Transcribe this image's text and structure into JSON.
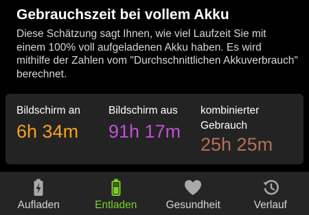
{
  "section": {
    "title": "Gebrauchszeit bei vollem Akku",
    "description": "Diese Schätzung sagt Ihnen, wie viel Laufzeit Sie mit einem 100% voll aufgeladenen Akku haben. Es wird mithilfe der Zahlen vom \"Durchschnittlichen Akkuverbrauch\" berechnet."
  },
  "stats": [
    {
      "label": "Bildschirm an",
      "value": "6h 34m",
      "color": "#f5a21b"
    },
    {
      "label": "Bildschirm aus",
      "value": "91h 17m",
      "color": "#c150d8"
    },
    {
      "label": "kombinierter Gebrauch",
      "value": "25h 25m",
      "color": "#b5705a"
    }
  ],
  "tabs": [
    {
      "label": "Aufladen",
      "icon": "battery-charging-icon",
      "active": false
    },
    {
      "label": "Entladen",
      "icon": "battery-discharging-icon",
      "active": true
    },
    {
      "label": "Gesundheit",
      "icon": "heart-icon",
      "active": false
    },
    {
      "label": "Verlauf",
      "icon": "history-icon",
      "active": false
    }
  ],
  "colors": {
    "background": "#000000",
    "card": "#232323",
    "tabbar": "#252525",
    "accent": "#7cd228"
  }
}
